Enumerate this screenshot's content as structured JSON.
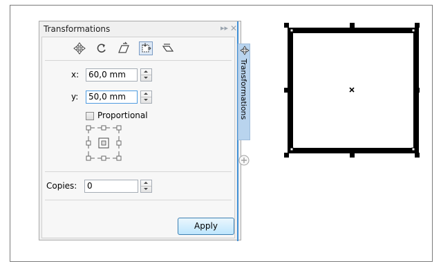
{
  "panel": {
    "title": "Transformations",
    "tab_label": "Transformations"
  },
  "toolbar": {
    "tools": [
      "position-icon",
      "rotate-icon",
      "scale-mirror-icon",
      "size-icon",
      "skew-icon"
    ],
    "active": "size-icon"
  },
  "fields": {
    "x_label": "x:",
    "x_value": "60,0 mm",
    "y_label": "y:",
    "y_value": "50,0 mm",
    "proportional_label": "Proportional",
    "proportional_checked": false,
    "copies_label": "Copies:",
    "copies_value": "0"
  },
  "buttons": {
    "apply_label": "Apply"
  },
  "colors": {
    "accent": "#3f8fd6",
    "tab_bg": "#b9d4ee",
    "apply_bg": "#bee6fd"
  }
}
